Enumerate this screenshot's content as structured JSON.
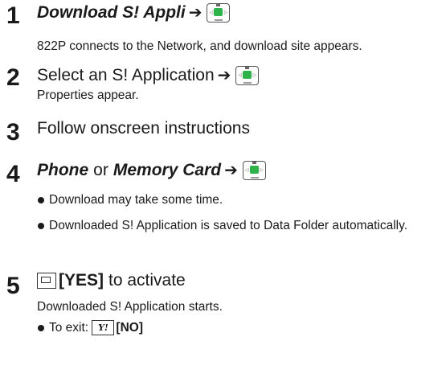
{
  "steps": [
    {
      "number": "1",
      "title": "Download S! Appli",
      "description": "822P connects to the Network, and download site appears."
    },
    {
      "number": "2",
      "title": "Select an S! Application",
      "description": "Properties appear."
    },
    {
      "number": "3",
      "title": "Follow onscreen instructions"
    },
    {
      "number": "4",
      "option_a": "Phone",
      "connector": "or",
      "option_b": "Memory Card",
      "bullets": [
        "Download may take some time.",
        "Downloaded S! Application is saved to Data Folder automatically."
      ]
    },
    {
      "number": "5",
      "key_label": "[YES]",
      "title_rest": "to activate",
      "description": "Downloaded S! Application starts.",
      "exit_prefix": "To exit:",
      "exit_key_glyph": "Y!",
      "exit_key_label": "[NO]"
    }
  ],
  "key_icon": {
    "left_glyph": "◁",
    "right_glyph": "▷",
    "button_color": "#2db34a"
  }
}
